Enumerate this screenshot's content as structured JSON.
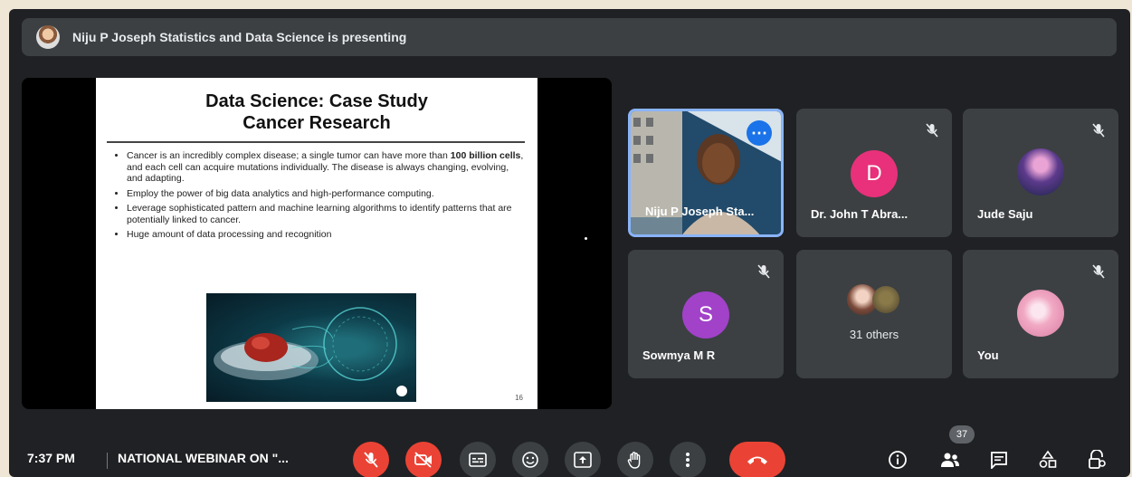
{
  "banner": {
    "text": "Niju P Joseph Statistics and Data Science is presenting"
  },
  "slide": {
    "title_line1": "Data Science: Case Study",
    "title_line2": "Cancer Research",
    "bullet1_pre": "Cancer is an incredibly complex disease; a single tumor can have more than ",
    "bullet1_bold": "100 billion cells",
    "bullet1_post": ", and each cell can acquire mutations individually. The disease is always changing, evolving, and adapting.",
    "bullet2": "Employ the power of big data analytics and high-performance computing.",
    "bullet3": "Leverage sophisticated pattern and machine learning algorithms to identify patterns that are potentially linked to cancer.",
    "bullet4": "Huge amount of data processing and recognition",
    "page_number": "16"
  },
  "participants": {
    "tile1": {
      "name": "Niju P Joseph Sta..."
    },
    "tile2": {
      "name": "Dr. John T Abra...",
      "initial": "D",
      "color": "#e8317a"
    },
    "tile3": {
      "name": "Jude Saju"
    },
    "tile4": {
      "name": "Sowmya M R",
      "initial": "S",
      "color": "#a142c9"
    },
    "tile5": {
      "label": "31 others"
    },
    "tile6": {
      "name": "You"
    }
  },
  "bottom_bar": {
    "time": "7:37 PM",
    "meeting_title": "NATIONAL WEBINAR ON \"...",
    "participant_count": "37"
  },
  "icons": {
    "mic": "mic-off-icon",
    "camera": "camera-off-icon",
    "captions": "captions-icon",
    "emoji": "emoji-icon",
    "present": "present-icon",
    "hand": "raise-hand-icon",
    "more": "more-vert-icon",
    "end": "call-end-icon",
    "info": "info-icon",
    "people": "people-icon",
    "chat": "chat-icon",
    "activities": "activities-icon",
    "lock": "host-controls-icon"
  },
  "colors": {
    "end_call": "#ea4335",
    "background": "#202124",
    "tile": "#3c4043",
    "active_border": "#8ab4f8"
  }
}
